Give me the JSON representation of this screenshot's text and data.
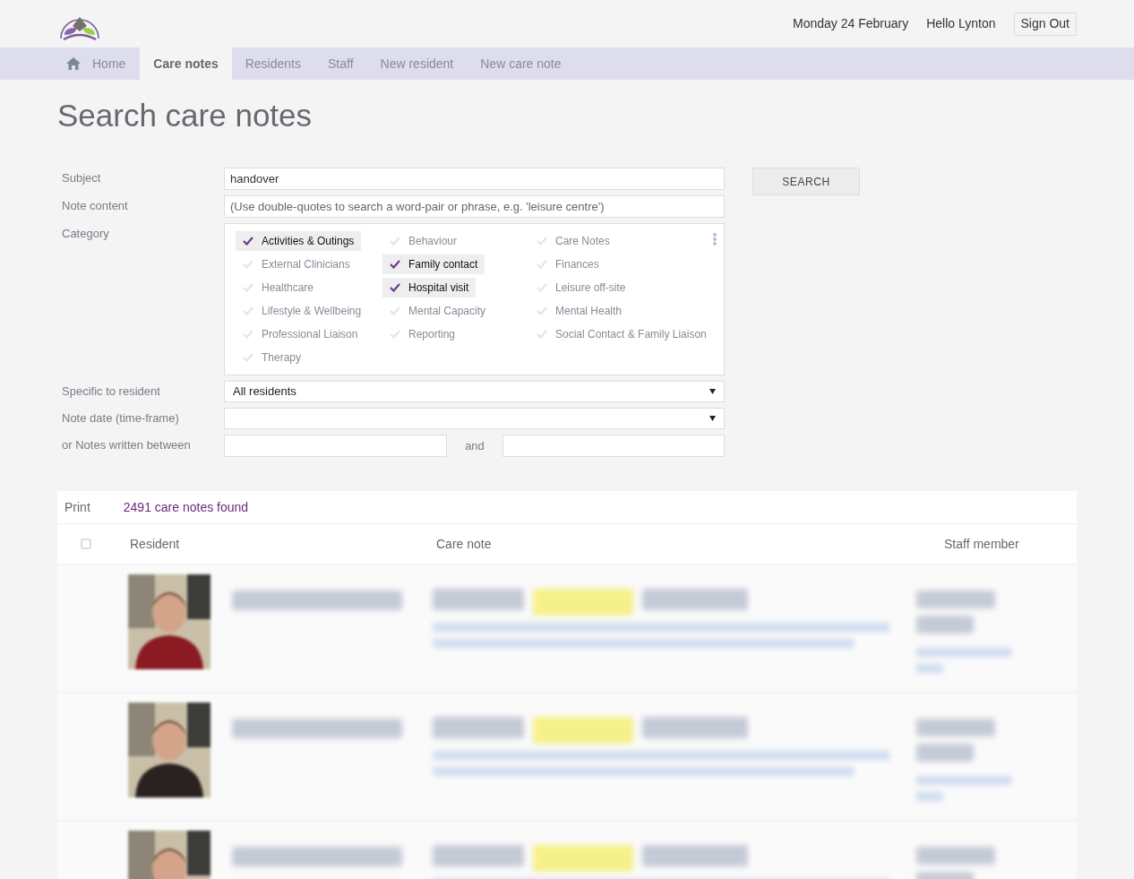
{
  "header": {
    "date": "Monday 24 February",
    "greeting": "Hello Lynton",
    "sign_out": "Sign Out"
  },
  "nav": [
    {
      "label": "Home",
      "kind": "home",
      "selected": false
    },
    {
      "label": "Care notes",
      "kind": "link",
      "selected": true
    },
    {
      "label": "Residents",
      "kind": "link",
      "selected": false
    },
    {
      "label": "Staff",
      "kind": "link",
      "selected": false
    },
    {
      "label": "New resident",
      "kind": "link",
      "selected": false
    },
    {
      "label": "New care note",
      "kind": "link",
      "selected": false
    }
  ],
  "title": "Search care notes",
  "form": {
    "subject": {
      "label": "Subject",
      "value": "handover"
    },
    "content": {
      "label": "Note content",
      "placeholder": "(Use double-quotes to search a word-pair or phrase, e.g. 'leisure centre')"
    },
    "category": {
      "label": "Category",
      "options": [
        {
          "label": "Activities & Outings",
          "checked": true
        },
        {
          "label": "Behaviour",
          "checked": false
        },
        {
          "label": "Care Notes",
          "checked": false
        },
        {
          "label": "External Clinicians",
          "checked": false
        },
        {
          "label": "Family contact",
          "checked": true
        },
        {
          "label": "Finances",
          "checked": false
        },
        {
          "label": "Healthcare",
          "checked": false
        },
        {
          "label": "Hospital visit",
          "checked": true
        },
        {
          "label": "Leisure off-site",
          "checked": false
        },
        {
          "label": "Lifestyle & Wellbeing",
          "checked": false
        },
        {
          "label": "Mental Capacity",
          "checked": false
        },
        {
          "label": "Mental Health",
          "checked": false
        },
        {
          "label": "Professional Liaison",
          "checked": false
        },
        {
          "label": "Reporting",
          "checked": false
        },
        {
          "label": "Social Contact & Family Liaison",
          "checked": false
        },
        {
          "label": "Therapy",
          "checked": false
        }
      ]
    },
    "resident": {
      "label": "Specific to resident",
      "value": "All residents"
    },
    "date": {
      "label": "Note date (time-frame)"
    },
    "between": {
      "label": "or Notes written between",
      "and": "and"
    },
    "search_button": "SEARCH"
  },
  "results": {
    "print": "Print",
    "count": "2491 care notes found",
    "columns": [
      "Resident",
      "Care note",
      "Staff member"
    ],
    "select_all_checked": false,
    "rows": [
      {
        "kind": "blurred"
      },
      {
        "kind": "blurred"
      },
      {
        "kind": "blurred"
      }
    ]
  }
}
